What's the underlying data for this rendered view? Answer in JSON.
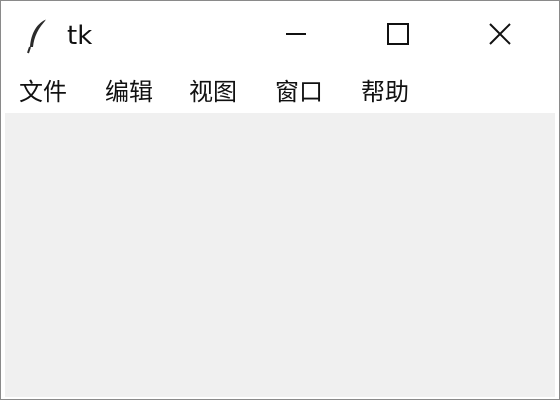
{
  "window": {
    "title": "tk",
    "icon": "feather-icon",
    "controls": {
      "minimize_icon": "minimize-icon",
      "maximize_icon": "maximize-icon",
      "close_icon": "close-icon"
    }
  },
  "menubar": {
    "items": [
      {
        "label": "文件"
      },
      {
        "label": "编辑"
      },
      {
        "label": "视图"
      },
      {
        "label": "窗口"
      },
      {
        "label": "帮助"
      }
    ]
  },
  "colors": {
    "client_background": "#f0f0f0",
    "chrome_background": "#ffffff",
    "text": "#111111"
  }
}
